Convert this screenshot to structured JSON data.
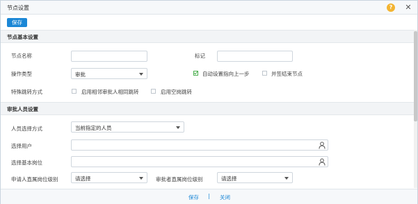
{
  "dialog": {
    "title": "节点设置",
    "help_glyph": "?",
    "close_glyph": "✕"
  },
  "toolbar": {
    "save_label": "保存"
  },
  "basic_section": {
    "title": "节点基本设置",
    "node_name_label": "节点名称",
    "node_name_value": "",
    "mark_label": "标记",
    "mark_value": "",
    "operation_type_label": "操作类型",
    "operation_type_value": "审批",
    "auto_back_label": "自动设置指向上一步",
    "auto_back_checked": true,
    "countersign_end_label": "并签结束节点",
    "countersign_end_checked": false,
    "special_jump_label": "特殊跳转方式",
    "jump_same_approver_label": "启用相邻审批人相同跳转",
    "jump_vacant_label": "启用空岗跳转"
  },
  "approver_section": {
    "title": "审批人员设置",
    "select_mode_label": "人员选择方式",
    "select_mode_value": "当前指定的人员",
    "select_user_label": "选择用户",
    "select_user_value": "",
    "select_post_label": "选择基本岗位",
    "select_post_value": "",
    "applicant_level_label": "申请人直属岗位级别",
    "applicant_level_value": "请选择",
    "approver_level_label": "审批者直属岗位级别",
    "approver_level_value": "请选择"
  },
  "footer": {
    "save_label": "保存",
    "separator": "|",
    "close_label": "关闭"
  },
  "colors": {
    "accent": "#1b87d6",
    "help": "#f3b431",
    "check": "#4caf50"
  }
}
